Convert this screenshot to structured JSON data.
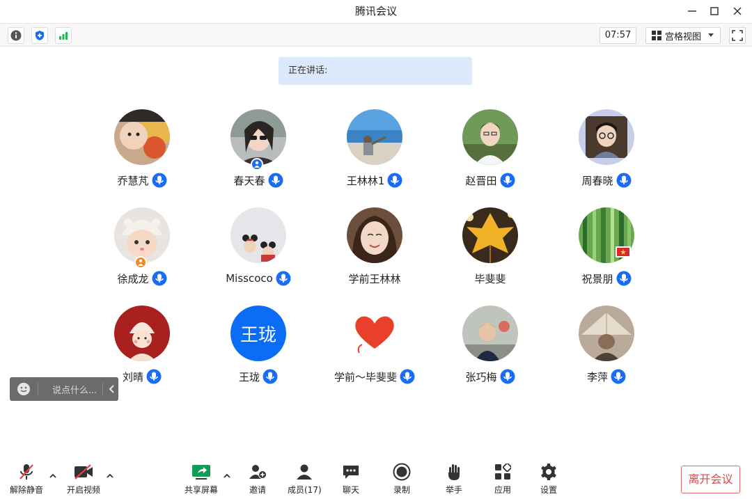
{
  "window": {
    "title": "腾讯会议"
  },
  "toolbar": {
    "timer": "07:57",
    "view_mode": "宫格视图"
  },
  "speaking": {
    "label": "正在讲话:"
  },
  "participants": [
    {
      "name": "乔慧芃",
      "mic": true,
      "avatar": "photo-child-flowers"
    },
    {
      "name": "春天春",
      "mic": true,
      "avatar": "photo-woman-sunglasses",
      "badge": "user-blue"
    },
    {
      "name": "王林林1",
      "mic": true,
      "avatar": "photo-beach"
    },
    {
      "name": "赵晋田",
      "mic": true,
      "avatar": "photo-man-glasses"
    },
    {
      "name": "周春晓",
      "mic": true,
      "avatar": "photo-boy-glasses"
    },
    {
      "name": "徐成龙",
      "mic": true,
      "avatar": "photo-baby-hat",
      "badge": "user-orange"
    },
    {
      "name": "Misscoco",
      "mic": true,
      "avatar": "photo-mice-toys"
    },
    {
      "name": "学前王林林",
      "mic": false,
      "avatar": "photo-woman-smile"
    },
    {
      "name": "毕斐斐",
      "mic": false,
      "avatar": "photo-autumn-leaf"
    },
    {
      "name": "祝景朋",
      "mic": true,
      "avatar": "photo-bamboo",
      "badge": "flag"
    },
    {
      "name": "刘晴",
      "mic": true,
      "avatar": "illustration-girl"
    },
    {
      "name": "王珑",
      "mic": true,
      "avatar": "text",
      "avatar_text": "王珑"
    },
    {
      "name": "学前～毕斐斐",
      "mic": true,
      "avatar": "heart"
    },
    {
      "name": "张巧梅",
      "mic": true,
      "avatar": "photo-boy"
    },
    {
      "name": "李萍",
      "mic": true,
      "avatar": "photo-straw-hat"
    }
  ],
  "chat": {
    "placeholder": "说点什么..."
  },
  "bottombar": {
    "unmute": "解除静音",
    "start_video": "开启视频",
    "share_screen": "共享屏幕",
    "invite": "邀请",
    "members": "成员(17)",
    "chat": "聊天",
    "record": "录制",
    "raise_hand": "举手",
    "apps": "应用",
    "settings": "设置",
    "leave": "离开会议"
  },
  "colors": {
    "accent_blue": "#1a6cf5",
    "speaking_bg": "#dce9fb",
    "leave_red": "#e04545",
    "avatar_blue": "#0b6cf6",
    "share_green": "#0f9d58"
  }
}
